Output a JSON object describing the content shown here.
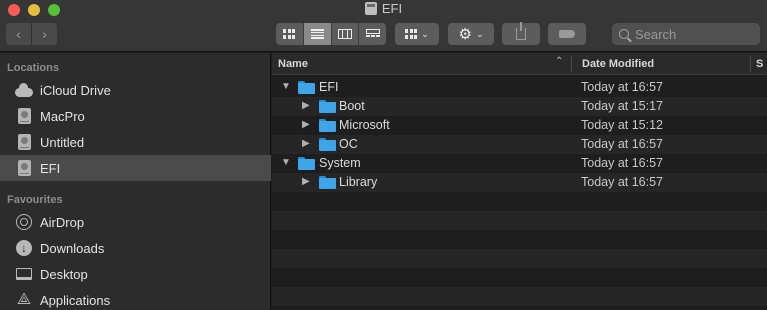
{
  "window": {
    "title": "EFI"
  },
  "toolbar": {
    "back_glyph": "‹",
    "forward_glyph": "›",
    "view_modes": [
      "icon-view",
      "list-view",
      "column-view",
      "gallery-view"
    ],
    "active_view": "list-view",
    "group_chevron": "⌄",
    "action_gear": "⚙",
    "action_chevron": "⌄",
    "search_placeholder": "Search"
  },
  "sidebar": {
    "locations_header": "Locations",
    "locations": [
      {
        "label": "iCloud Drive",
        "icon": "cloud-icon"
      },
      {
        "label": "MacPro",
        "icon": "drive-icon"
      },
      {
        "label": "Untitled",
        "icon": "drive-icon"
      },
      {
        "label": "EFI",
        "icon": "drive-icon",
        "selected": true
      }
    ],
    "favourites_header": "Favourites",
    "favourites": [
      {
        "label": "AirDrop",
        "icon": "airdrop-icon"
      },
      {
        "label": "Downloads",
        "icon": "downloads-icon"
      },
      {
        "label": "Desktop",
        "icon": "desktop-icon"
      },
      {
        "label": "Applications",
        "icon": "applications-icon"
      }
    ]
  },
  "columns": {
    "name": "Name",
    "date_modified": "Date Modified",
    "size_partial": "S"
  },
  "files": [
    {
      "name": "EFI",
      "date": "Today at 16:57",
      "level": 0,
      "expanded": true
    },
    {
      "name": "Boot",
      "date": "Today at 15:17",
      "level": 1,
      "expanded": false
    },
    {
      "name": "Microsoft",
      "date": "Today at 15:12",
      "level": 1,
      "expanded": false
    },
    {
      "name": "OC",
      "date": "Today at 16:57",
      "level": 1,
      "expanded": false
    },
    {
      "name": "System",
      "date": "Today at 16:57",
      "level": 0,
      "expanded": true
    },
    {
      "name": "Library",
      "date": "Today at 16:57",
      "level": 1,
      "expanded": false
    }
  ],
  "colors": {
    "folder": "#3da5e8",
    "selection": "#4b4b4b"
  }
}
